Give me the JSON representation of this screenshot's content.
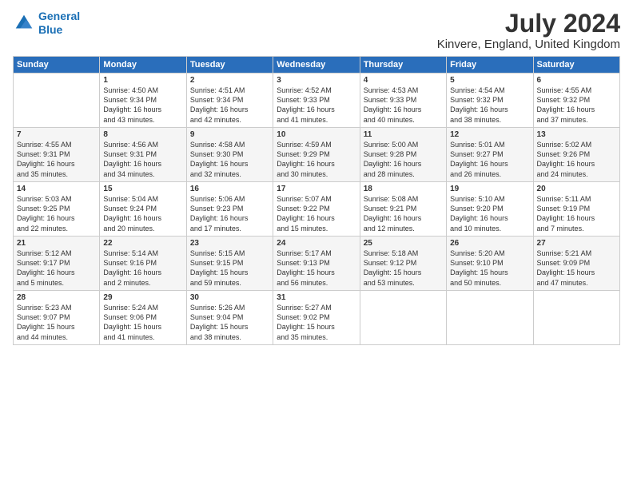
{
  "logo": {
    "line1": "General",
    "line2": "Blue"
  },
  "title": "July 2024",
  "subtitle": "Kinvere, England, United Kingdom",
  "header_days": [
    "Sunday",
    "Monday",
    "Tuesday",
    "Wednesday",
    "Thursday",
    "Friday",
    "Saturday"
  ],
  "weeks": [
    [
      {
        "day": "",
        "content": ""
      },
      {
        "day": "1",
        "content": "Sunrise: 4:50 AM\nSunset: 9:34 PM\nDaylight: 16 hours\nand 43 minutes."
      },
      {
        "day": "2",
        "content": "Sunrise: 4:51 AM\nSunset: 9:34 PM\nDaylight: 16 hours\nand 42 minutes."
      },
      {
        "day": "3",
        "content": "Sunrise: 4:52 AM\nSunset: 9:33 PM\nDaylight: 16 hours\nand 41 minutes."
      },
      {
        "day": "4",
        "content": "Sunrise: 4:53 AM\nSunset: 9:33 PM\nDaylight: 16 hours\nand 40 minutes."
      },
      {
        "day": "5",
        "content": "Sunrise: 4:54 AM\nSunset: 9:32 PM\nDaylight: 16 hours\nand 38 minutes."
      },
      {
        "day": "6",
        "content": "Sunrise: 4:55 AM\nSunset: 9:32 PM\nDaylight: 16 hours\nand 37 minutes."
      }
    ],
    [
      {
        "day": "7",
        "content": "Sunrise: 4:55 AM\nSunset: 9:31 PM\nDaylight: 16 hours\nand 35 minutes."
      },
      {
        "day": "8",
        "content": "Sunrise: 4:56 AM\nSunset: 9:31 PM\nDaylight: 16 hours\nand 34 minutes."
      },
      {
        "day": "9",
        "content": "Sunrise: 4:58 AM\nSunset: 9:30 PM\nDaylight: 16 hours\nand 32 minutes."
      },
      {
        "day": "10",
        "content": "Sunrise: 4:59 AM\nSunset: 9:29 PM\nDaylight: 16 hours\nand 30 minutes."
      },
      {
        "day": "11",
        "content": "Sunrise: 5:00 AM\nSunset: 9:28 PM\nDaylight: 16 hours\nand 28 minutes."
      },
      {
        "day": "12",
        "content": "Sunrise: 5:01 AM\nSunset: 9:27 PM\nDaylight: 16 hours\nand 26 minutes."
      },
      {
        "day": "13",
        "content": "Sunrise: 5:02 AM\nSunset: 9:26 PM\nDaylight: 16 hours\nand 24 minutes."
      }
    ],
    [
      {
        "day": "14",
        "content": "Sunrise: 5:03 AM\nSunset: 9:25 PM\nDaylight: 16 hours\nand 22 minutes."
      },
      {
        "day": "15",
        "content": "Sunrise: 5:04 AM\nSunset: 9:24 PM\nDaylight: 16 hours\nand 20 minutes."
      },
      {
        "day": "16",
        "content": "Sunrise: 5:06 AM\nSunset: 9:23 PM\nDaylight: 16 hours\nand 17 minutes."
      },
      {
        "day": "17",
        "content": "Sunrise: 5:07 AM\nSunset: 9:22 PM\nDaylight: 16 hours\nand 15 minutes."
      },
      {
        "day": "18",
        "content": "Sunrise: 5:08 AM\nSunset: 9:21 PM\nDaylight: 16 hours\nand 12 minutes."
      },
      {
        "day": "19",
        "content": "Sunrise: 5:10 AM\nSunset: 9:20 PM\nDaylight: 16 hours\nand 10 minutes."
      },
      {
        "day": "20",
        "content": "Sunrise: 5:11 AM\nSunset: 9:19 PM\nDaylight: 16 hours\nand 7 minutes."
      }
    ],
    [
      {
        "day": "21",
        "content": "Sunrise: 5:12 AM\nSunset: 9:17 PM\nDaylight: 16 hours\nand 5 minutes."
      },
      {
        "day": "22",
        "content": "Sunrise: 5:14 AM\nSunset: 9:16 PM\nDaylight: 16 hours\nand 2 minutes."
      },
      {
        "day": "23",
        "content": "Sunrise: 5:15 AM\nSunset: 9:15 PM\nDaylight: 15 hours\nand 59 minutes."
      },
      {
        "day": "24",
        "content": "Sunrise: 5:17 AM\nSunset: 9:13 PM\nDaylight: 15 hours\nand 56 minutes."
      },
      {
        "day": "25",
        "content": "Sunrise: 5:18 AM\nSunset: 9:12 PM\nDaylight: 15 hours\nand 53 minutes."
      },
      {
        "day": "26",
        "content": "Sunrise: 5:20 AM\nSunset: 9:10 PM\nDaylight: 15 hours\nand 50 minutes."
      },
      {
        "day": "27",
        "content": "Sunrise: 5:21 AM\nSunset: 9:09 PM\nDaylight: 15 hours\nand 47 minutes."
      }
    ],
    [
      {
        "day": "28",
        "content": "Sunrise: 5:23 AM\nSunset: 9:07 PM\nDaylight: 15 hours\nand 44 minutes."
      },
      {
        "day": "29",
        "content": "Sunrise: 5:24 AM\nSunset: 9:06 PM\nDaylight: 15 hours\nand 41 minutes."
      },
      {
        "day": "30",
        "content": "Sunrise: 5:26 AM\nSunset: 9:04 PM\nDaylight: 15 hours\nand 38 minutes."
      },
      {
        "day": "31",
        "content": "Sunrise: 5:27 AM\nSunset: 9:02 PM\nDaylight: 15 hours\nand 35 minutes."
      },
      {
        "day": "",
        "content": ""
      },
      {
        "day": "",
        "content": ""
      },
      {
        "day": "",
        "content": ""
      }
    ]
  ]
}
